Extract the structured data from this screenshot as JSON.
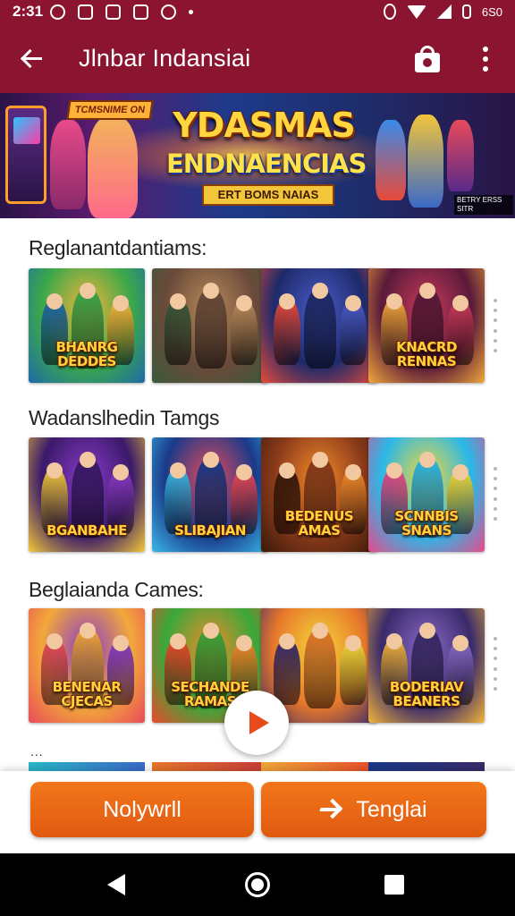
{
  "status_bar": {
    "time": "2:31",
    "battery_text": "6S0"
  },
  "app_bar": {
    "title": "Jlnbar Indansiai",
    "back_icon": "arrow-left-icon",
    "bag_icon": "shopping-bag-icon",
    "more_icon": "more-vert-icon"
  },
  "banner": {
    "title_line1": "YDASMAS",
    "title_line2": "ENDNAENCIAS",
    "subtitle": "ERT BOMS NAIAS",
    "corner_tag": "TCMSNIME ON",
    "badge": "BETRY ERSS SITR"
  },
  "sections": [
    {
      "title": "Reglanantdantiams:",
      "tiles": [
        {
          "label": "BHANRG\nDEDDES",
          "colors": [
            "#3aa84a",
            "#f2b43a",
            "#1e6aa8"
          ]
        },
        {
          "label": "",
          "colors": [
            "#6a4a3a",
            "#b88a5a",
            "#3a5a3a"
          ]
        },
        {
          "label": "",
          "colors": [
            "#1e2a6a",
            "#4a5ac8",
            "#e84a3a"
          ]
        },
        {
          "label": "KNACRD\nRENNAS",
          "colors": [
            "#5a1a3a",
            "#c83a5a",
            "#f2a83a"
          ]
        }
      ]
    },
    {
      "title": "Wadanslhedin Tamgs",
      "tiles": [
        {
          "label": "BGANBAHE",
          "colors": [
            "#3a1a6a",
            "#8a3ac8",
            "#f2c83a"
          ]
        },
        {
          "label": "SLIBAJIAN",
          "colors": [
            "#1a3a8a",
            "#e84a5a",
            "#3ab8e8"
          ]
        },
        {
          "label": "BEDENUS\nAMAS",
          "colors": [
            "#8a3a1a",
            "#f28a2a",
            "#3a1a0a"
          ]
        },
        {
          "label": "SCNNBIS\nSNANS",
          "colors": [
            "#2ab8e8",
            "#f2d83a",
            "#e84a8a"
          ]
        }
      ]
    },
    {
      "title": "Beglaianda Cames:",
      "tiles": [
        {
          "label": "BENENAR\nCJECAS",
          "colors": [
            "#f2a83a",
            "#8a3ac8",
            "#e84a5a"
          ]
        },
        {
          "label": "SECHANDE\nRAMAS",
          "colors": [
            "#3aa83a",
            "#f28a2a",
            "#e84a2a"
          ]
        },
        {
          "label": "",
          "colors": [
            "#e8782a",
            "#f2d83a",
            "#3a2a6a"
          ]
        },
        {
          "label": "BODERIAV\nBEANERS",
          "colors": [
            "#3a2a6a",
            "#8a6ac8",
            "#f2b43a"
          ]
        }
      ]
    }
  ],
  "partial_section_title": "...",
  "play_button_icon": "play-icon",
  "buttons": {
    "left_label": "Nolywrll",
    "right_label": "Tenglai",
    "right_icon": "arrow-right-icon"
  },
  "nav": {
    "back_icon": "triangle-back-icon",
    "home_icon": "home-circle-icon",
    "recent_icon": "square-recents-icon"
  }
}
